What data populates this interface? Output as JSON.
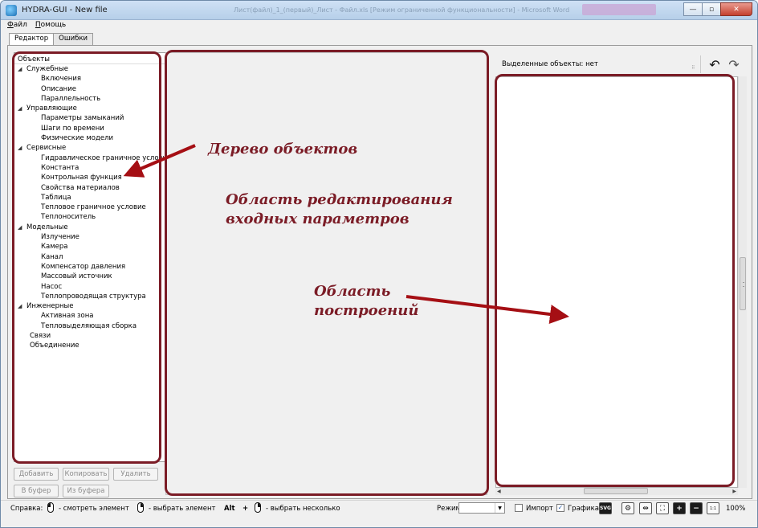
{
  "window": {
    "title": "HYDRA-GUI - New file",
    "bg_title": "Лист(файл)_1_(первый)_Лист - Файл.xls [Режим ограниченной функциональности] - Microsoft Word"
  },
  "titlebar_buttons": {
    "minimize": "—",
    "maximize": "▫",
    "close": "✕"
  },
  "menu": [
    {
      "accel": "Ф",
      "rest": "айл"
    },
    {
      "accel": "П",
      "rest": "омощь"
    }
  ],
  "tabs": [
    "Редактор",
    "Ошибки"
  ],
  "tree": {
    "header": "Объекты",
    "groups": [
      {
        "label": "Служебные",
        "items": [
          "Включения",
          "Описание",
          "Параллельность"
        ]
      },
      {
        "label": "Управляющие",
        "items": [
          "Параметры замыканий",
          "Шаги по времени",
          "Физические модели"
        ]
      },
      {
        "label": "Сервисные",
        "items": [
          "Гидравлическое граничное условие",
          "Константа",
          "Контрольная функция",
          "Свойства материалов",
          "Таблица",
          "Тепловое граничное условие",
          "Теплоноситель"
        ]
      },
      {
        "label": "Модельные",
        "items": [
          "Излучение",
          "Камера",
          "Канал",
          "Компенсатор давления",
          "Массовый источник",
          "Насос",
          "Теплопроводящая структура"
        ]
      },
      {
        "label": "Инженерные",
        "items": [
          "Активная зона",
          "Тепловыделяющая сборка"
        ]
      }
    ],
    "leaves": [
      "Связи",
      "Объединение"
    ]
  },
  "left_buttons": {
    "add": "Добавить",
    "copy": "Копировать",
    "delete": "Удалить",
    "to_buffer": "В буфер",
    "from_buffer": "Из буфера"
  },
  "right": {
    "selected_label": "Выделенные объекты: нет",
    "undo": "↶",
    "redo": "↷"
  },
  "statusbar": {
    "help": "Справка:",
    "view_hint": "- смотреть элемент",
    "select_hint": "- выбрать элемент",
    "alt": "Alt",
    "plus": "+",
    "multi_hint": "- выбрать несколько",
    "mode_label": "Режим",
    "mode_value": "",
    "import_label": "Импорт",
    "import_checked": false,
    "graphics_label": "Графика",
    "graphics_checked": true,
    "svg_label": "SVG",
    "zoom": "100%"
  },
  "annotations": {
    "tree": "Дерево объектов",
    "edit_line1": "Область редактирования",
    "edit_line2": "входных параметров",
    "plot_line1": "Область",
    "plot_line2": "построений"
  },
  "colors": {
    "annotation": "#7b1c26",
    "titlebar": "#b6cfe9"
  }
}
